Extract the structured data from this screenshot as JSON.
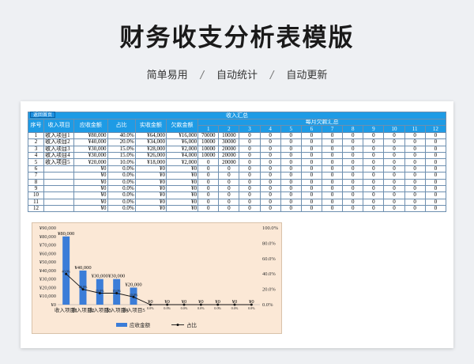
{
  "header": {
    "title": "财务收支分析表模版",
    "features": [
      "简单易用",
      "自动统计",
      "自动更新"
    ],
    "separator": "/"
  },
  "sheet": {
    "return_label": "返回首页",
    "group_header": "收入汇总",
    "monthly_header": "每月欠款汇总",
    "columns": [
      "序号",
      "收入项目",
      "应收金额",
      "占比",
      "实收金额",
      "欠款金额"
    ],
    "months": [
      "1",
      "2",
      "3",
      "4",
      "5",
      "6",
      "7",
      "8",
      "9",
      "10",
      "11",
      "12"
    ],
    "rows": [
      {
        "no": "1",
        "item": "收入项目1",
        "due": "¥80,000",
        "ratio": "40.0%",
        "received": "¥64,000",
        "owed": "¥16,000",
        "m": [
          "70000",
          "10000",
          "0",
          "0",
          "0",
          "0",
          "0",
          "0",
          "0",
          "0",
          "0",
          "0"
        ]
      },
      {
        "no": "2",
        "item": "收入项目2",
        "due": "¥40,000",
        "ratio": "20.0%",
        "received": "¥34,000",
        "owed": "¥6,000",
        "m": [
          "10000",
          "30000",
          "0",
          "0",
          "0",
          "0",
          "0",
          "0",
          "0",
          "0",
          "0",
          "0"
        ]
      },
      {
        "no": "3",
        "item": "收入项目3",
        "due": "¥30,000",
        "ratio": "15.0%",
        "received": "¥28,000",
        "owed": "¥2,000",
        "m": [
          "10000",
          "20000",
          "0",
          "0",
          "0",
          "0",
          "0",
          "0",
          "0",
          "0",
          "0",
          "0"
        ]
      },
      {
        "no": "4",
        "item": "收入项目4",
        "due": "¥30,000",
        "ratio": "15.0%",
        "received": "¥26,000",
        "owed": "¥4,000",
        "m": [
          "10000",
          "20000",
          "0",
          "0",
          "0",
          "0",
          "0",
          "0",
          "0",
          "0",
          "0",
          "0"
        ]
      },
      {
        "no": "5",
        "item": "收入项目5",
        "due": "¥20,000",
        "ratio": "10.0%",
        "received": "¥18,000",
        "owed": "¥2,000",
        "m": [
          "0",
          "20000",
          "0",
          "0",
          "0",
          "0",
          "0",
          "0",
          "0",
          "0",
          "0",
          "0"
        ]
      },
      {
        "no": "6",
        "item": "",
        "due": "¥0",
        "ratio": "0.0%",
        "received": "¥0",
        "owed": "¥0",
        "m": [
          "0",
          "0",
          "0",
          "0",
          "0",
          "0",
          "0",
          "0",
          "0",
          "0",
          "0",
          "0"
        ]
      },
      {
        "no": "7",
        "item": "",
        "due": "¥0",
        "ratio": "0.0%",
        "received": "¥0",
        "owed": "¥0",
        "m": [
          "0",
          "0",
          "0",
          "0",
          "0",
          "0",
          "0",
          "0",
          "0",
          "0",
          "0",
          "0"
        ]
      },
      {
        "no": "8",
        "item": "",
        "due": "¥0",
        "ratio": "0.0%",
        "received": "¥0",
        "owed": "¥0",
        "m": [
          "0",
          "0",
          "0",
          "0",
          "0",
          "0",
          "0",
          "0",
          "0",
          "0",
          "0",
          "0"
        ]
      },
      {
        "no": "9",
        "item": "",
        "due": "¥0",
        "ratio": "0.0%",
        "received": "¥0",
        "owed": "¥0",
        "m": [
          "0",
          "0",
          "0",
          "0",
          "0",
          "0",
          "0",
          "0",
          "0",
          "0",
          "0",
          "0"
        ]
      },
      {
        "no": "10",
        "item": "",
        "due": "¥0",
        "ratio": "0.0%",
        "received": "¥0",
        "owed": "¥0",
        "m": [
          "0",
          "0",
          "0",
          "0",
          "0",
          "0",
          "0",
          "0",
          "0",
          "0",
          "0",
          "0"
        ]
      },
      {
        "no": "11",
        "item": "",
        "due": "¥0",
        "ratio": "0.0%",
        "received": "¥0",
        "owed": "¥0",
        "m": [
          "0",
          "0",
          "0",
          "0",
          "0",
          "0",
          "0",
          "0",
          "0",
          "0",
          "0",
          "0"
        ]
      },
      {
        "no": "12",
        "item": "",
        "due": "¥0",
        "ratio": "0.0%",
        "received": "¥0",
        "owed": "¥0",
        "m": [
          "0",
          "0",
          "0",
          "0",
          "0",
          "0",
          "0",
          "0",
          "0",
          "0",
          "0",
          "0"
        ]
      }
    ]
  },
  "chart_data": {
    "type": "bar",
    "categories": [
      "收入项目1",
      "收入项目2",
      "收入项目3",
      "收入项目4",
      "收入项目5",
      "",
      "",
      "",
      "",
      "",
      "",
      ""
    ],
    "series": [
      {
        "name": "应收金额",
        "type": "bar",
        "axis": "left",
        "values": [
          80000,
          40000,
          30000,
          30000,
          20000,
          0,
          0,
          0,
          0,
          0,
          0,
          0
        ],
        "labels": [
          "¥80,000",
          "¥40,000",
          "¥30,000",
          "¥30,000",
          "¥20,000",
          "¥0",
          "¥0",
          "¥0",
          "¥0",
          "¥0",
          "¥0",
          "¥0"
        ]
      },
      {
        "name": "占比",
        "type": "line",
        "axis": "right",
        "values": [
          40,
          20,
          15,
          15,
          10,
          0,
          0,
          0,
          0,
          0,
          0,
          0
        ],
        "labels": [
          "40.0%",
          "20.0%",
          "15.0%",
          "15.0%",
          "10.0%",
          "0.0%",
          "0.0%",
          "0.0%",
          "0.0%",
          "0.0%",
          "0.0%",
          "0.0%"
        ]
      }
    ],
    "ylim": [
      0,
      90000
    ],
    "yticks": [
      "¥0",
      "¥10,000",
      "¥20,000",
      "¥30,000",
      "¥40,000",
      "¥50,000",
      "¥60,000",
      "¥70,000",
      "¥80,000",
      "¥90,000"
    ],
    "y2lim": [
      0,
      100
    ],
    "y2ticks": [
      "0.0%",
      "20.0%",
      "40.0%",
      "60.0%",
      "80.0%",
      "100.0%"
    ],
    "legend_position": "bottom",
    "colors": {
      "bar": "#3b7dd8",
      "line": "#111111",
      "background": "#fbe8d6"
    }
  }
}
